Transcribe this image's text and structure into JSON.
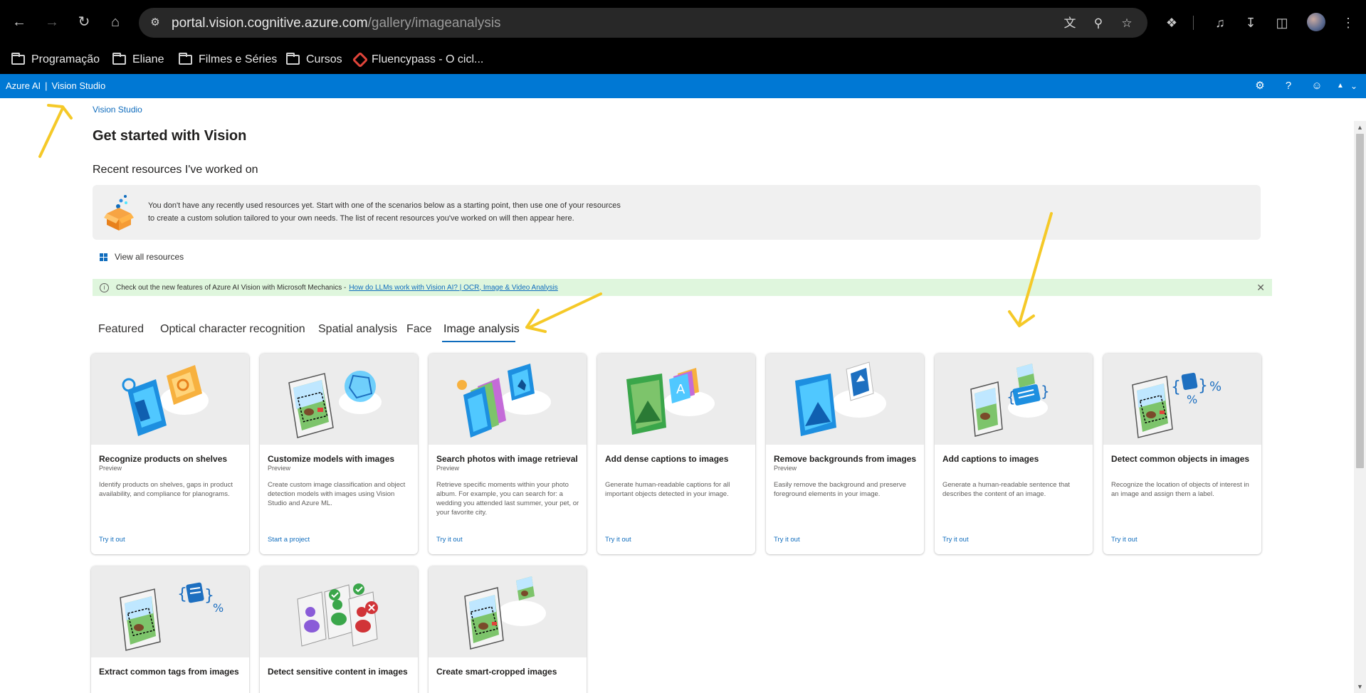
{
  "browser": {
    "url_domain": "portal.vision.cognitive.azure.com",
    "url_path": "/gallery/imageanalysis",
    "bookmarks": [
      {
        "label": "Programação"
      },
      {
        "label": "Eliane"
      },
      {
        "label": "Filmes e Séries"
      },
      {
        "label": "Cursos"
      },
      {
        "label": "Fluencypass - O cicl..."
      }
    ]
  },
  "app": {
    "brand_left": "Azure AI",
    "brand_separator": "|",
    "brand_right": "Vision Studio"
  },
  "page": {
    "breadcrumb": "Vision Studio",
    "title": "Get started with Vision",
    "recent_title": "Recent resources I've worked on",
    "empty_line1": "You don't have any recently used resources yet. Start with one of the scenarios below as a starting point, then use one of your resources",
    "empty_line2": "to create a custom solution tailored to your own needs. The list of recent resources you've worked on will then appear here.",
    "view_all": "View all resources",
    "banner_text": "Check out the new features of Azure AI Vision with Microsoft Mechanics -",
    "banner_link": "How do LLMs work with Vision AI? | OCR, Image & Video Analysis"
  },
  "tabs": [
    {
      "label": "Featured"
    },
    {
      "label": "Optical character recognition"
    },
    {
      "label": "Spatial analysis"
    },
    {
      "label": "Face"
    },
    {
      "label": "Image analysis",
      "active": true
    }
  ],
  "cards": [
    {
      "title": "Recognize products on shelves",
      "badge": "Preview",
      "description": "Identify products on shelves, gaps in product availability, and compliance for planograms.",
      "link": "Try it out",
      "icon": "shelf-products-icon"
    },
    {
      "title": "Customize models with images",
      "badge": "Preview",
      "description": "Create custom image classification and object detection models with images using Vision Studio and Azure ML.",
      "link": "Start a project",
      "icon": "custom-model-icon"
    },
    {
      "title": "Search photos with image retrieval",
      "badge": "Preview",
      "description": "Retrieve specific moments within your photo album. For example, you can search for: a wedding you attended last summer, your pet, or your favorite city.",
      "link": "Try it out",
      "icon": "image-retrieval-icon"
    },
    {
      "title": "Add dense captions to images",
      "badge": "",
      "description": "Generate human-readable captions for all important objects detected in your image.",
      "link": "Try it out",
      "icon": "dense-captions-icon"
    },
    {
      "title": "Remove backgrounds from images",
      "badge": "Preview",
      "description": "Easily remove the background and preserve foreground elements in your image.",
      "link": "Try it out",
      "icon": "remove-background-icon"
    },
    {
      "title": "Add captions to images",
      "badge": "",
      "description": "Generate a human-readable sentence that describes the content of an image.",
      "link": "Try it out",
      "icon": "captions-icon"
    },
    {
      "title": "Detect common objects in images",
      "badge": "",
      "description": "Recognize the location of objects of interest in an image and assign them a label.",
      "link": "Try it out",
      "icon": "object-detection-icon"
    },
    {
      "title": "Extract common tags from images",
      "badge": "",
      "description": "",
      "link": "",
      "icon": "tags-icon"
    },
    {
      "title": "Detect sensitive content in images",
      "badge": "",
      "description": "",
      "link": "",
      "icon": "sensitive-content-icon"
    },
    {
      "title": "Create smart-cropped images",
      "badge": "",
      "description": "",
      "link": "",
      "icon": "smart-crop-icon"
    }
  ],
  "colors": {
    "azure_blue": "#0078d4",
    "link_blue": "#0f6cbd",
    "banner_green": "#dff6dd",
    "annotation_yellow": "#f5c928"
  }
}
